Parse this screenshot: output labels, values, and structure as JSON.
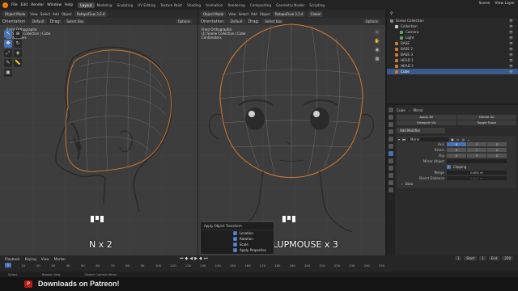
{
  "menu": {
    "items": [
      "File",
      "Edit",
      "Render",
      "Window",
      "Help"
    ]
  },
  "workspaces": {
    "items": [
      "Layout",
      "Modeling",
      "Sculpting",
      "UV Editing",
      "Texture Paint",
      "Shading",
      "Animation",
      "Rendering",
      "Compositing",
      "Geometry Nodes",
      "Scripting"
    ],
    "active": "Layout"
  },
  "topright": {
    "scene": "Scene",
    "view_layer": "View Layer"
  },
  "left_viewport": {
    "mode": "Object Mode",
    "view": "View",
    "select": "Select",
    "add": "Add",
    "object": "Object",
    "addon": "RetopoFlow 3.2.4",
    "orientation_label": "Orientation:",
    "orientation": "Default",
    "drag_label": "Drag:",
    "drag": "Select Box",
    "options": "Options",
    "info_line1": "Right Orthographic",
    "info_line2": "(1) Scene Collection | Cube",
    "info_line3": "Centimeters",
    "overlay_text": "N x 2"
  },
  "right_viewport": {
    "mode": "Object Mode",
    "view": "View",
    "select": "Select",
    "add": "Add",
    "object": "Object",
    "addon": "RetopoFlow 3.2.4",
    "global": "Global",
    "orientation_label": "Orientation:",
    "orientation": "Default",
    "drag_label": "Drag:",
    "drag": "Select Box",
    "options": "Options",
    "info_line1": "Front Orthographic",
    "info_line2": "(1) Scene Collection | Cube",
    "info_line3": "Centimeters",
    "overlay_text": "LUPMOUSE x 3"
  },
  "apply_panel": {
    "title": "Apply Object Transform",
    "options": [
      {
        "label": "Location",
        "checked": true
      },
      {
        "label": "Rotation",
        "checked": true
      },
      {
        "label": "Scale",
        "checked": true
      },
      {
        "label": "Apply Properties",
        "checked": true
      }
    ]
  },
  "outliner": {
    "title": "Scene Collection",
    "rows": [
      {
        "label": "Scene Collection",
        "indent": 0,
        "color": "#888888",
        "selected": false
      },
      {
        "label": "Collection",
        "indent": 1,
        "color": "#cccccc",
        "selected": false
      },
      {
        "label": "Camera",
        "indent": 2,
        "color": "#63a36a",
        "selected": false
      },
      {
        "label": "Light",
        "indent": 2,
        "color": "#63a36a",
        "selected": false
      },
      {
        "label": "BASE",
        "indent": 1,
        "color": "#d07a2f",
        "selected": false
      },
      {
        "label": "BASE 2",
        "indent": 1,
        "color": "#d07a2f",
        "selected": false
      },
      {
        "label": "BASE 3",
        "indent": 1,
        "color": "#d07a2f",
        "selected": false
      },
      {
        "label": "HEAD 1",
        "indent": 1,
        "color": "#d07a2f",
        "selected": false
      },
      {
        "label": "HEAD 2",
        "indent": 1,
        "color": "#d07a2f",
        "selected": false
      },
      {
        "label": "Cube",
        "indent": 1,
        "color": "#d07a2f",
        "selected": true
      }
    ]
  },
  "properties": {
    "object": "Cube",
    "modifier_name": "Mirror",
    "buttons": [
      "Apply All",
      "Delete All",
      "Viewport Vis",
      "Toggle Stack"
    ],
    "add_modifier": "Add Modifier",
    "mirror_name": "Mirror",
    "axis_label": "Axis",
    "bisect_label": "Bisect",
    "flip_label": "Flip",
    "axis_x": "X",
    "axis_y": "Y",
    "axis_z": "Z",
    "mirror_object_label": "Mirror Object",
    "clipping_label": "Clipping",
    "merge_label": "Merge",
    "merge_value": "0.001 m",
    "bisect_distance_label": "Bisect Distance",
    "bisect_distance_value": "0.001 m",
    "data_label": "Data"
  },
  "timeline": {
    "playback": "Playback",
    "keying": "Keying",
    "view": "View",
    "marker": "Marker",
    "current_frame": "1",
    "frames": [
      "0",
      "10",
      "20",
      "30",
      "40",
      "50",
      "60",
      "70",
      "80",
      "90",
      "100",
      "110",
      "120",
      "130",
      "140",
      "150",
      "160",
      "170",
      "180",
      "190",
      "200",
      "210",
      "220",
      "230",
      "240",
      "250"
    ],
    "start_label": "Start",
    "start": "1",
    "end_label": "End",
    "end": "250"
  },
  "statusbar": {
    "select": "Select",
    "rotate_view": "Rotate View",
    "context_menu": "Object Context Menu"
  },
  "banner": {
    "text": "Downloads on Patreon!"
  }
}
